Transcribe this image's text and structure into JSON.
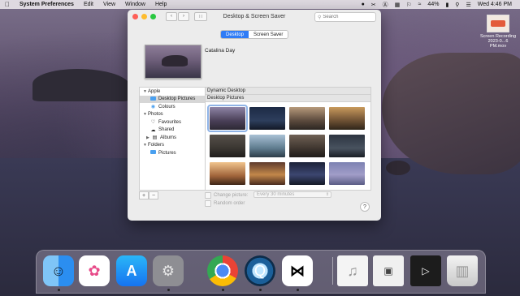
{
  "colors": {
    "accent": "#2f7cf6",
    "close": "#fe5f57",
    "minimize": "#febc2e",
    "zoom": "#28c840"
  },
  "menubar": {
    "apple_icon": "apple-logo-icon",
    "app": "System Preferences",
    "items": [
      "Edit",
      "View",
      "Window",
      "Help"
    ],
    "battery": "44%",
    "clock": "Wed 4:46 PM"
  },
  "desktop_file": {
    "line1": "Screen Recording",
    "line2": "2023-0...6 PM.mov"
  },
  "window": {
    "title": "Desktop & Screen Saver",
    "search_placeholder": "Search",
    "tabs": [
      {
        "label": "Desktop",
        "active": true
      },
      {
        "label": "Screen Saver",
        "active": false
      }
    ],
    "current_wallpaper": "Catalina Day",
    "sidebar": [
      {
        "label": "Apple",
        "level": 0,
        "icon": "disclosure-open-icon"
      },
      {
        "label": "Desktop Pictures",
        "level": 1,
        "icon": "folder-icon",
        "selected": true
      },
      {
        "label": "Colours",
        "level": 1,
        "icon": "color-wheel-icon"
      },
      {
        "label": "Photos",
        "level": 0,
        "icon": "disclosure-open-icon"
      },
      {
        "label": "Favourites",
        "level": 1,
        "icon": "heart-icon"
      },
      {
        "label": "Shared",
        "level": 1,
        "icon": "cloud-icon"
      },
      {
        "label": "Albums",
        "level": 1,
        "icon": "album-icon"
      },
      {
        "label": "Folders",
        "level": 0,
        "icon": "disclosure-open-icon"
      },
      {
        "label": "Pictures",
        "level": 1,
        "icon": "folder-icon"
      }
    ],
    "sections": {
      "dynamic": "Dynamic Desktop",
      "pictures": "Desktop Pictures"
    },
    "change_picture": "Change picture:",
    "interval": "Every 30 minutes",
    "random_order": "Random order",
    "help": "?"
  },
  "dock": [
    {
      "name": "Finder",
      "icon": "finder-icon"
    },
    {
      "name": "Photos",
      "icon": "photos-icon"
    },
    {
      "name": "App Store",
      "icon": "app-store-icon"
    },
    {
      "name": "System Preferences",
      "icon": "system-preferences-icon"
    },
    {
      "name": "Google Chrome",
      "icon": "chrome-icon"
    },
    {
      "name": "QuickTime Player",
      "icon": "quicktime-icon"
    },
    {
      "name": "CapCut",
      "icon": "capcut-icon"
    },
    {
      "name": "Music file",
      "icon": "music-file-icon"
    },
    {
      "name": "Chrome window",
      "icon": "chrome-window-icon"
    },
    {
      "name": "CapCut window",
      "icon": "capcut-window-icon"
    },
    {
      "name": "Trash",
      "icon": "trash-icon"
    }
  ]
}
